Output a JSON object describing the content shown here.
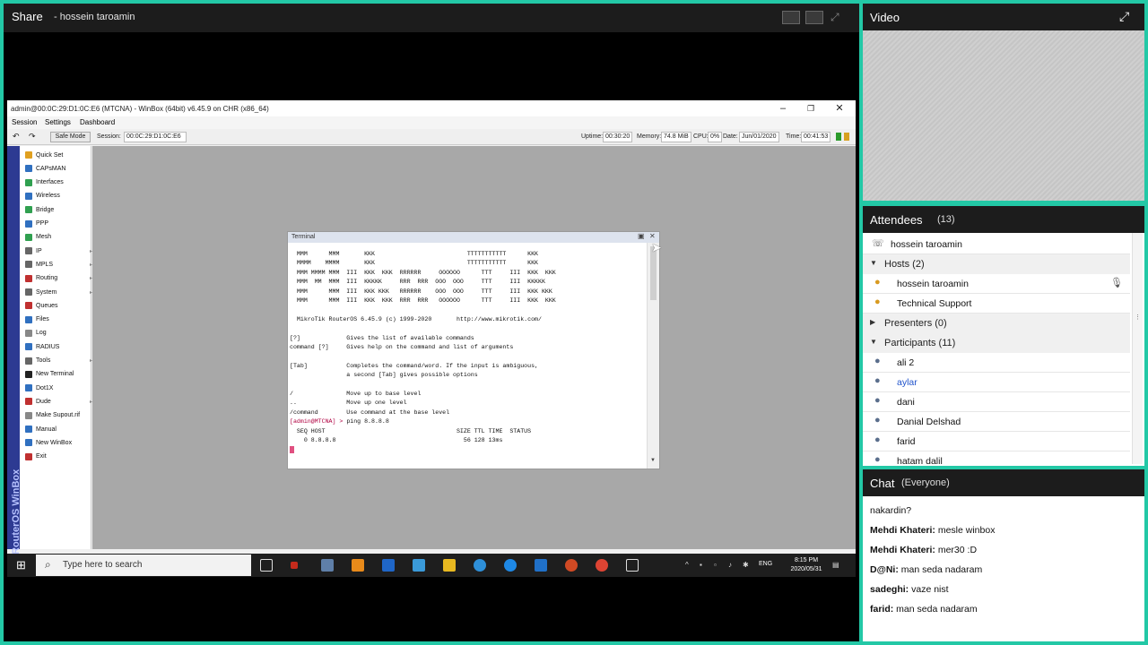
{
  "share": {
    "title": "Share",
    "presenter": "- hossein taroamin"
  },
  "winbox": {
    "title": "admin@00:0C:29:D1:0C:E6 (MTCNA) - WinBox (64bit) v6.45.9 on CHR (x86_64)",
    "menu": [
      "Session",
      "Settings",
      "Dashboard"
    ],
    "safe_mode": "Safe Mode",
    "session_label": "Session:",
    "session_value": "00:0C:29:D1:0C:E6",
    "uptime_label": "Uptime:",
    "uptime": "00:30:20",
    "memory_label": "Memory:",
    "memory": "74.8 MiB",
    "cpu_label": "CPU:",
    "cpu": "0%",
    "date_label": "Date:",
    "date": "Jun/01/2020",
    "time_label": "Time:",
    "time": "00:41:53",
    "side_text": "RouterOS WinBox",
    "sidebar": [
      {
        "label": "Quick Set",
        "color": "#e0a020"
      },
      {
        "label": "CAPsMAN",
        "color": "#3070c0"
      },
      {
        "label": "Interfaces",
        "color": "#30a050"
      },
      {
        "label": "Wireless",
        "color": "#3070c0"
      },
      {
        "label": "Bridge",
        "color": "#30a050"
      },
      {
        "label": "PPP",
        "color": "#3070c0"
      },
      {
        "label": "Mesh",
        "color": "#30a050"
      },
      {
        "label": "IP",
        "color": "#666666",
        "arrow": true
      },
      {
        "label": "MPLS",
        "color": "#666666",
        "arrow": true
      },
      {
        "label": "Routing",
        "color": "#c03030",
        "arrow": true
      },
      {
        "label": "System",
        "color": "#666666",
        "arrow": true
      },
      {
        "label": "Queues",
        "color": "#c03030"
      },
      {
        "label": "Files",
        "color": "#3070c0"
      },
      {
        "label": "Log",
        "color": "#888888"
      },
      {
        "label": "RADIUS",
        "color": "#3070c0"
      },
      {
        "label": "Tools",
        "color": "#666666",
        "arrow": true
      },
      {
        "label": "New Terminal",
        "color": "#222222"
      },
      {
        "label": "Dot1X",
        "color": "#3070c0"
      },
      {
        "label": "Dude",
        "color": "#c03030",
        "arrow": true
      },
      {
        "label": "Make Supout.rif",
        "color": "#888888"
      },
      {
        "label": "Manual",
        "color": "#3070c0"
      },
      {
        "label": "New WinBox",
        "color": "#3070c0"
      },
      {
        "label": "Exit",
        "color": "#c03030"
      }
    ]
  },
  "terminal": {
    "title": "Terminal",
    "lines": [
      "  MMM      MMM       KKK                          TTTTTTTTTTT      KKK",
      "  MMMM    MMMM       KKK                          TTTTTTTTTTT      KKK",
      "  MMM MMMM MMM  III  KKK  KKK  RRRRRR     OOOOOO      TTT     III  KKK  KKK",
      "  MMM  MM  MMM  III  KKKKK     RRR  RRR  OOO  OOO     TTT     III  KKKKK",
      "  MMM      MMM  III  KKK KKK   RRRRRR    OOO  OOO     TTT     III  KKK KKK",
      "  MMM      MMM  III  KKK  KKK  RRR  RRR   OOOOOO      TTT     III  KKK  KKK",
      "",
      "  MikroTik RouterOS 6.45.9 (c) 1999-2020       http://www.mikrotik.com/",
      "",
      "[?]             Gives the list of available commands",
      "command [?]     Gives help on the command and list of arguments",
      "",
      "[Tab]           Completes the command/word. If the input is ambiguous,",
      "                a second [Tab] gives possible options",
      "",
      "/               Move up to base level",
      "..              Move up one level",
      "/command        Use command at the base level"
    ],
    "prompt": "[admin@MTCNA] > ",
    "command": "ping 8.8.8.8",
    "ping_header": "  SEQ HOST                                     SIZE TTL TIME  STATUS",
    "ping_row": "    0 8.8.8.8                                    56 128 13ms"
  },
  "taskbar": {
    "search_placeholder": "Type here to search",
    "lang": "ENG",
    "clock_time": "8:15 PM",
    "clock_date": "2020/05/31"
  },
  "video": {
    "title": "Video"
  },
  "attendees": {
    "title": "Attendees",
    "count": "(13)",
    "self": "hossein taroamin",
    "hosts_label": "Hosts (2)",
    "hosts": [
      "hossein taroamin",
      "Technical Support"
    ],
    "presenters_label": "Presenters (0)",
    "participants_label": "Participants (11)",
    "participants": [
      "ali 2",
      "aylar",
      "dani",
      "Danial Delshad",
      "farid",
      "hatam dalil"
    ]
  },
  "chat": {
    "title": "Chat",
    "scope": "(Everyone)",
    "messages": [
      {
        "sender": "",
        "text": "nakardin?"
      },
      {
        "sender": "Mehdi Khateri:",
        "text": "mesle winbox"
      },
      {
        "sender": "Mehdi Khateri:",
        "text": "mer30 :D"
      },
      {
        "sender": "D@Ni:",
        "text": "man seda nadaram"
      },
      {
        "sender": "sadeghi:",
        "text": "vaze nist"
      },
      {
        "sender": "farid:",
        "text": "man seda nadaram"
      }
    ]
  },
  "colors": {
    "accent": "#23c8a6",
    "header_bg": "#1c1c1c",
    "winbox_side": "#2d3a92",
    "highlight_name": "#2255cc"
  }
}
